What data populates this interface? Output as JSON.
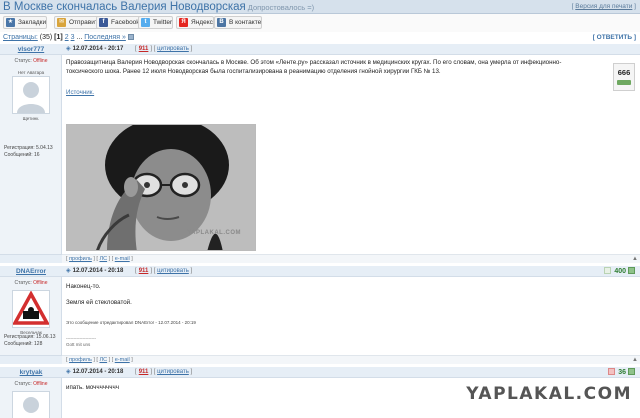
{
  "header": {
    "title": "В Москве скончалась Валерия Новодворская",
    "subtitle": "Допростовалось =)",
    "print_link": "Версия для печати"
  },
  "share": [
    {
      "label": "Закладки",
      "icon": "bookmark-icon",
      "color": "#4a76a8"
    },
    {
      "label": "Отправить",
      "icon": "mail-icon",
      "color": "#d9a43b"
    },
    {
      "label": "Facebook",
      "icon": "facebook-icon",
      "color": "#3b5998"
    },
    {
      "label": "Twitter",
      "icon": "twitter-icon",
      "color": "#55acee"
    },
    {
      "label": "Яндекс",
      "icon": "yandex-icon",
      "color": "#e52620"
    },
    {
      "label": "В контакте",
      "icon": "vk-icon",
      "color": "#4c75a3"
    }
  ],
  "pagination": {
    "label": "Страницы:",
    "count": "(35)",
    "current": "1",
    "pages": [
      "2",
      "3"
    ],
    "ellipsis": "...",
    "last": "Последняя »",
    "reply": "[ ОТВЕТИТЬ ]"
  },
  "posts": [
    {
      "author": "vlsor777",
      "status_label": "Статус:",
      "status": "Offline",
      "avatar_caption_top": "Нет Аватара",
      "avatar_caption": "Щетинк.",
      "reg_label": "Регистрация:",
      "reg": "5.04.13",
      "msgs_label": "Сообщений:",
      "msgs": "16",
      "date": "12.07.2014 - 20:17",
      "number": "911",
      "quote": "цитировать",
      "text": "Правозащитница Валерия Новодворская скончалась в Москве. Об этом «Ленте.ру» рассказал источник в медицинских кругах. По его словам, она умерла от инфекционно-токсического шока. Ранее 12 июля Новодворская была госпитализирована в реанимацию отделения гнойной хирургии ГКБ № 13.",
      "source": "Источник.",
      "rating": "666",
      "watermark": "YAPLAKAL.COM"
    },
    {
      "author": "DNAError",
      "status_label": "Статус:",
      "status": "Offline",
      "avatar_caption": "Весельчак",
      "reg_label": "Регистрация:",
      "reg": "15.06.13",
      "msgs_label": "Сообщений:",
      "msgs": "128",
      "date": "12.07.2014 - 20:18",
      "number": "911",
      "quote": "цитировать",
      "text1": "Наконец-то.",
      "text2": "Земля ей стекловатой.",
      "edit_note": "Это сообщение отредактировал DNAError - 12.07.2014 - 20:19",
      "divider": "--------------------",
      "signature": "Gott mit uns",
      "rating": "400"
    },
    {
      "author": "krytyak",
      "status_label": "Статус:",
      "status": "Offline",
      "date": "12.07.2014 - 20:18",
      "number": "911",
      "quote": "цитировать",
      "text": "ипать. мочччччччч",
      "rating": "36"
    }
  ],
  "footer_links": {
    "profile": "профиль",
    "pm": "ЛС",
    "email": "e-mail"
  },
  "watermark": "YAPLAKAL.COM"
}
